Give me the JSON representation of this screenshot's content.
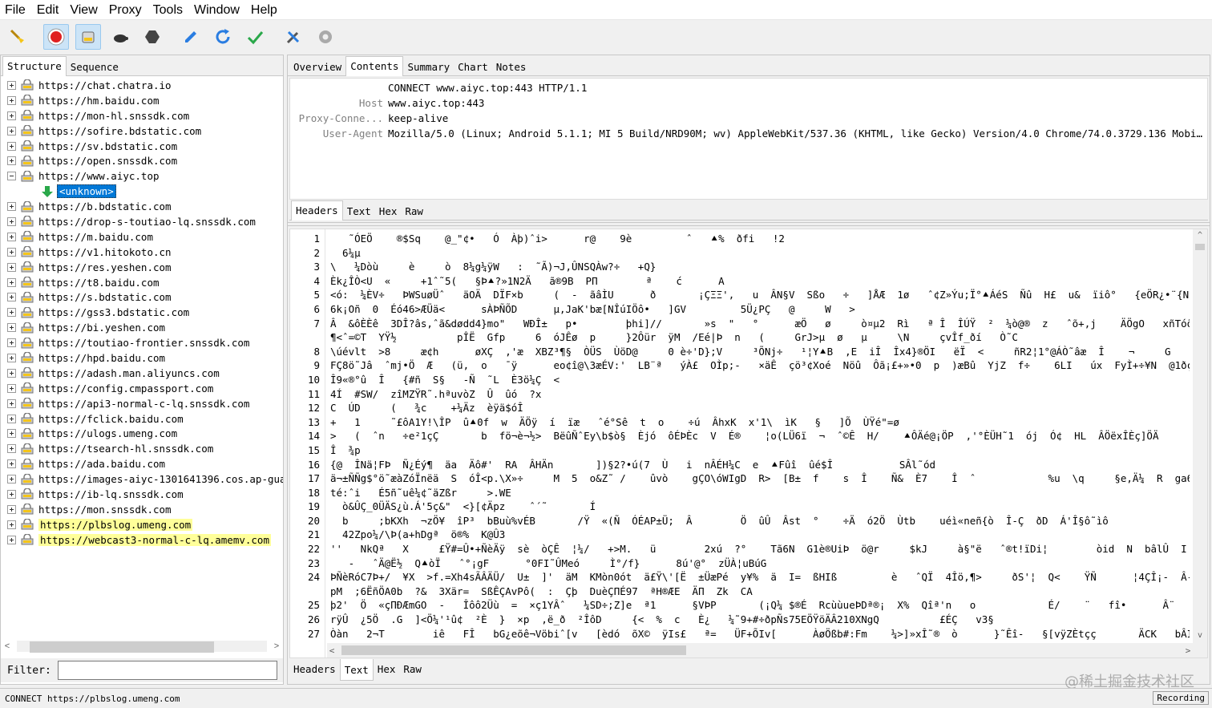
{
  "menu": [
    "File",
    "Edit",
    "View",
    "Proxy",
    "Tools",
    "Window",
    "Help"
  ],
  "toolbar": {
    "buttons": [
      "broom-icon",
      "record-icon",
      "throttle-icon",
      "turtle-icon",
      "breakpoint-icon",
      "edit-pen-icon",
      "repeat-icon",
      "validate-check-icon",
      "tools-icon",
      "settings-gear-icon"
    ]
  },
  "left": {
    "tabs": [
      "Structure",
      "Sequence"
    ],
    "hosts": [
      "https://chat.chatra.io",
      "https://hm.baidu.com",
      "https://mon-hl.snssdk.com",
      "https://sofire.bdstatic.com",
      "https://sv.bdstatic.com",
      "https://open.snssdk.com",
      "https://www.aiyc.top",
      "https://b.bdstatic.com",
      "https://drop-s-toutiao-lq.snssdk.com",
      "https://m.baidu.com",
      "https://v1.hitokoto.cn",
      "https://res.yeshen.com",
      "https://t8.baidu.com",
      "https://s.bdstatic.com",
      "https://gss3.bdstatic.com",
      "https://bi.yeshen.com",
      "https://toutiao-frontier.snssdk.com",
      "https://hpd.baidu.com",
      "https://adash.man.aliyuncs.com",
      "https://config.cmpassport.com",
      "https://api3-normal-c-lq.snssdk.com",
      "https://fclick.baidu.com",
      "https://ulogs.umeng.com",
      "https://tsearch-hl.snssdk.com",
      "https://ada.baidu.com",
      "https://images-aiyc-1301641396.cos.ap-guang",
      "https://ib-lq.snssdk.com",
      "https://mon.snssdk.com",
      "https://plbslog.umeng.com",
      "https://webcast3-normal-c-lq.amemv.com"
    ],
    "expanded_child": "<unknown>",
    "filter_label": "Filter:",
    "filter_value": ""
  },
  "right": {
    "tabs": [
      "Overview",
      "Contents",
      "Summary",
      "Chart",
      "Notes"
    ],
    "request_line": "CONNECT www.aiyc.top:443 HTTP/1.1",
    "headers": [
      {
        "key": "Host",
        "value": "www.aiyc.top:443"
      },
      {
        "key": "Proxy-Conne...",
        "value": "keep-alive"
      },
      {
        "key": "User-Agent",
        "value": "Mozilla/5.0 (Linux; Android 5.1.1; MI 5  Build/NRD90M; wv) AppleWebKit/537.36 (KHTML, like Gecko) Version/4.0 Chrome/74.0.3729.136 Mobile Sa..."
      }
    ],
    "request_tabs": [
      "Headers",
      "Text",
      "Hex",
      "Raw"
    ],
    "response_tabs": [
      "Headers",
      "Text",
      "Hex",
      "Raw"
    ],
    "line_numbers": [
      "1",
      "2",
      "3",
      "4",
      "5",
      "6",
      "7",
      "",
      "8",
      "9",
      "10",
      "11",
      "12",
      "13",
      "14",
      "15",
      "16",
      "17",
      "18",
      "19",
      "20",
      "21",
      "22",
      "23",
      "24",
      "",
      "25",
      "26",
      "27"
    ],
    "body_lines": [
      "   ˜ÓEÖ    ®$Sq    @_\"¢•   Ó  Àþ)ˆi>      r@    9è         ˆ   ⯅%  ðfi   !2",
      "  6¼µ",
      "\\   ¼Dòù     è     ò  8¼g¼ÿW   :  ˜Ã)¬J,ÛNSQÀw?÷   +Q}",
      "Èk¿ÎÒ<U  «     +1ˆ˜5(   §Þ⯅?»1N2Ä   ã®9B  PΠ        ª    ć      A",
      "<ó:  ¼ÈV÷   ÞWSuøÜˆ   äOÄ  DÏF×b     (  -  ãâÌU      ð       ¡ÇΞΞ',   u  ÂN§V  Sßo   ÷   ]ÅÆ  1ø   ˆ¢Z»Ýu;Ï°⯅ÁéS  Ñû  H£  u&  ïiô°   {eÖR¿•¨{N",
      "6k¡Oñ  0  Éó46>ÆÜä<      sÀÞÑÕD      µ,JaK'bæ[NÎúIÖô•   ]GV         5Ü¿PÇ   @     W   >",
      "Â  &ôÈÈê  3DÎ?âs,ˆã&dødd4}mo\"   WÐÎ±   p•        þhi]//       »s  \"   °      æÖ   ø     ò¤µ2  Rì   ª Î  ÎÚŸ  ²  ¼ò@®  z   ˆõ+,j    ÄÖgO   xñTóôA¦       ò³³wàð¦Ñ",
      "¶<ˆ=©T  YŸ½          pÎË  Gfp     6  óJÊø  p     }2Ôür  ÿM  /Eé|Þ  n   (     GrJ>µ  ø   µ     \\N     çvÎf_ðí   Ò˜C",
      "\\úévlt  >8     æ¢h      øXÇ  ,'æ  XBZ³¶§  ÒÜS  ÙöD@     0 è÷'D};V     ³ÕNj÷   ¹¦Y⯅B  ,E  iÎ  Îx4}®ÖI   ëÏ  <     ñR2¦1°@ÁÒ˜âæ  Î    ¬     G     þH³ˆ•¦>É½*dÇ",
      "FÇ8ö˜Jâ  ˆmj•Ö  Æ   (ü,  o   ¯ÿ      eo¢î@\\3æÉV:'  LB¨ª   ýÀ£  OÌp;-   ×äÊ  çö³¢Xoé  Nöû  Ôã¡£+»•0  p  )æBû  YjZ  f÷    6LI   úx  FyÌ+÷¥N  @1ðçå  ?",
      "Î9«®°û  Î   {#ñ  S§   -Ñ  ˜L  È3ö¼Ç  <",
      "4Í  #SW/  zîMZŸR˜.hªuvòZ  Û  ûó  ?x",
      "C  ÚD     (   ¾c    +¼Äz  èÿä$óÎ",
      "+   1     ˜£ôA1Y!\\ÎP  û⯅0f  w  ÄÖÿ  í  ïæ   ˆé°Sê  t  o    ÷ú  ÂhxK  x'1\\  ìK   §   ]Õ  ÙŸé\"=ø",
      ">   (  ˆn   ÷e²1çÇ       b  fö¬è¬½>  BëûÑˆEy\\b$ò§  Èjó  ôÉÞÈc  V  É®    ¦o(LÜ6ï  ¬  ˆ©Ê  H/    ⯅ÔÄé@¡ÖP  ,'°ÈÜH˜1  ój  Ó¢  HL  ÂÖëxÎÈç]ÖÄ",
      "Î  ¾p",
      "{@  ÎNä¦FÞ  Ñ¿Éý¶  äa  Äô#'  RA  ÂHÄn       ])§2?•ú(7  Ù   i  nÂÉH¼C  e  ⯅Fûî  ûé$Î           SÂl˜ód",
      "ä¬±ÑÑg$°ö˜æàZóÏnëä  S  óÎ<p.\\X»÷     M  5  o&Z˜ /    ûvò    gÇO\\óWIgD  R>  [B±  f    s  Î    Ñ&  È7    Î  ˆ            %u  \\q     §e,Ä¼  R  ga6f     $",
      "té:ˆi   É5ñ˜uê¼¢˜äZßr     >.WE",
      "  ò&ÛÇ_0ÜÄS¿ù.Á'5ç&\"  <}[¢Äpz    ˆ´˜       Í",
      "  b     ;bKXh  ¬zÖ¥  îP³  bBuù%vÉB       /Ÿ  «(Ñ  ÓÉAP±Ü;  Â        Ö  ûÛ  Âst  °    ÷Ä  ó2Ö  Ùtb    uéì«neñ{ò  Î-Ç  ðD  Á'Î§ô˜ìô                {•    ° w",
      "  42Zpo¼/\\Þ(a+hDgª  ö®%  K@Û3",
      "''   NkQª   X     £Ÿ#=Û•+ÑèÄÿ  sè  òÇÊ  ¦¼/   +>M.   ü        2xú  ?°    Tã6N  G1è®UiÞ  ö@r     $kJ     à§\"ë   ˆ®t!ïDi¦        òid  N  bâlÛ  I  Çió˜\\¼Äê  ±î4ðÎ",
      "   -   ˆÄ@Ë½  Q⯅òÏ   ˆ°¡gF      °0FI˜ÛMeó     Ì°/f}      8ú'@°  zÜÀ¦uBúG",
      "ÞÑèRóC7Þ+/  ¥X  >f.=Xh4sÃÂÄÜ/  U±  ]'  äM  KMòn0ót  ä£Ÿ\\'[Ë  ±ÜæPé  y¥%  ä  I=  ßHIß         è   ˆQÏ  4Îö,¶>     ðS'¦  Q<    ŸÑ      ¦4ÇÎ¡-  Â-P,  Â  ä",
      "pM  ;6ËñÖA0b  ?&  3Xär=  SßÊÇAvPô(  :  Çþ  DuèÇΠÉ97  ªH®ÆE  ÄΠ  Zk  CA",
      "þ2'  Ö  «çΠÐÆmGO  -   Îôô2Üù  =  ×ç1YÂˆ   ¼SD÷;Z]e  ª1      §VÞP       (¡Q¼ $®É  RcùùueÞDª®¡  X%  Qîª'n   o            É/    ¨   fî•      Â¨   K¦§ï÷ÀZ˜O  *âå  Ÿe",
      "rÿÛ  ¿5Ö  .G  ]<Ö¼'¹û¢  ²È  }  ×p  ,ë_ð  ²ÎôD     {<  %  c   È¿   ¼˜9+#÷ðpÑs75EÖŸöÄÂ210XNgQ          £ÉÇ   v3§",
      "Òàn   2¬T        iê   FÎ   bG¿eõê¬Vöbiˆ[v   [èdó  õX©  ÿIs£   ª=   ÜF+ÕIv[      ÀøÖßb#:Fm    ¼>]»xÎ˜®  ò      }˜Êî-   §[vÿZÈtçç       ÄCK   bÂI×OK#   Xè   HHO˜¼Ìå¤îr¥"
    ],
    "scroll_arrows": {
      "left": "<",
      "right": ">",
      "up": "^",
      "down": "v"
    }
  },
  "status": {
    "left_text": "CONNECT https://plbslog.umeng.com",
    "recording": "Recording"
  },
  "watermark": "@稀土掘金技术社区",
  "colors": {
    "selection": "#0078d7",
    "highlight": "#ffff99",
    "record_red": "#e02020"
  }
}
